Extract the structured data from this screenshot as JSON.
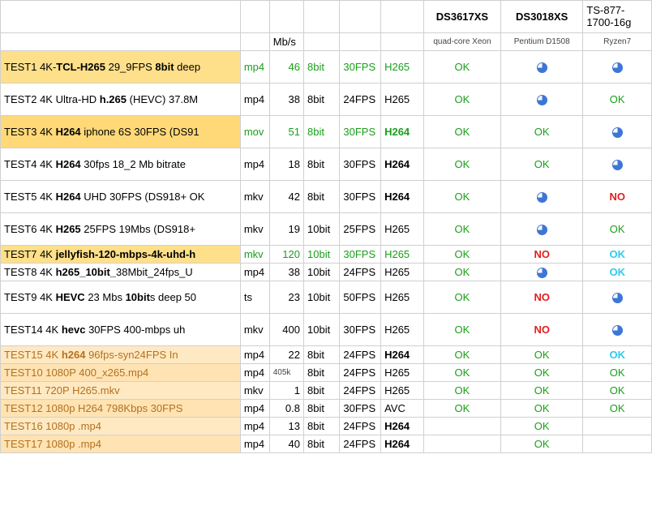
{
  "headers": {
    "r1": {
      "m1": "DS3617XS",
      "m2": "DS3018XS",
      "m3": "TS-877-1700-16g"
    },
    "r2": {
      "mb": "Mb/s",
      "m1": "quad-core Xeon",
      "m2": "Pentium D1508",
      "m3": "Ryzen7"
    }
  },
  "rows": [
    {
      "big": true,
      "bg": "bg-y1",
      "d": [
        [
          "TEST1 4K-"
        ],
        [
          "TCL-H265",
          "b"
        ],
        [
          " 29_9FPS "
        ],
        [
          "8bit",
          "b"
        ],
        [
          " deep"
        ]
      ],
      "dc": "",
      "ext": "mp4",
      "extc": "green",
      "mb": "46",
      "mbc": "r green",
      "bit": "8bit",
      "bitc": "green",
      "fps": "30FPS",
      "fpsc": "green",
      "cod": "H265",
      "codc": "green",
      "m1": "OK",
      "m2": "PIE",
      "m3": "PIE"
    },
    {
      "big": true,
      "bg": "",
      "d": [
        [
          "TEST2 4K Ultra-HD "
        ],
        [
          "h.265",
          "b"
        ],
        [
          " (HEVC) 37.8M"
        ]
      ],
      "dc": "",
      "ext": "mp4",
      "extc": "",
      "mb": "38",
      "mbc": "r",
      "bit": "8bit",
      "bitc": "",
      "fps": "24FPS",
      "fpsc": "",
      "cod": "H265",
      "codc": "",
      "m1": "OK",
      "m2": "PIE",
      "m3": "OK"
    },
    {
      "big": true,
      "bg": "bg-y2",
      "d": [
        [
          "TEST3 4K "
        ],
        [
          "H264",
          "b"
        ],
        [
          " iphone 6S 30FPS (DS91"
        ]
      ],
      "dc": "",
      "ext": "mov",
      "extc": "green",
      "mb": "51",
      "mbc": "r green",
      "bit": "8bit",
      "bitc": "green",
      "fps": "30FPS",
      "fpsc": "green",
      "cod": "H264",
      "codc": "green bold",
      "m1": "OK",
      "m2": "OK",
      "m3": "PIE"
    },
    {
      "big": true,
      "bg": "",
      "d": [
        [
          "TEST4 4K "
        ],
        [
          "H264",
          "b"
        ],
        [
          " 30fps 18_2 Mb bitrate"
        ]
      ],
      "dc": "",
      "ext": "mp4",
      "extc": "",
      "mb": "18",
      "mbc": "r",
      "bit": "8bit",
      "bitc": "",
      "fps": "30FPS",
      "fpsc": "",
      "cod": "H264",
      "codc": "bold",
      "m1": "OK",
      "m2": "OK",
      "m3": "PIE"
    },
    {
      "big": true,
      "bg": "",
      "d": [
        [
          "TEST5 4K "
        ],
        [
          "H264",
          "b"
        ],
        [
          " UHD 30FPS (DS918+ OK"
        ]
      ],
      "dc": "",
      "ext": "mkv",
      "extc": "",
      "mb": "42",
      "mbc": "r",
      "bit": "8bit",
      "bitc": "",
      "fps": "30FPS",
      "fpsc": "",
      "cod": "H264",
      "codc": "bold",
      "m1": "OK",
      "m2": "PIE",
      "m3": "NO"
    },
    {
      "big": true,
      "bg": "",
      "d": [
        [
          "TEST6 4K "
        ],
        [
          "H265",
          "b"
        ],
        [
          " 25FPS 19Mbs (DS918+ "
        ]
      ],
      "dc": "",
      "ext": "mkv",
      "extc": "",
      "mb": "19",
      "mbc": "r",
      "bit": "10bit",
      "bitc": "",
      "fps": "25FPS",
      "fpsc": "",
      "cod": "H265",
      "codc": "",
      "m1": "OK",
      "m2": "PIE",
      "m3": "OK"
    },
    {
      "big": false,
      "bg": "bg-y1",
      "d": [
        [
          "TEST7 4K "
        ],
        [
          "jellyfish-120-mbps-4k-uhd-h",
          "b"
        ]
      ],
      "dc": "",
      "ext": "mkv",
      "extc": "green",
      "mb": "120",
      "mbc": "r green",
      "bit": "10bit",
      "bitc": "green",
      "fps": "30FPS",
      "fpsc": "green",
      "cod": "H265",
      "codc": "green",
      "m1": "OK",
      "m2": "NO",
      "m3": "OKc"
    },
    {
      "big": false,
      "bg": "",
      "d": [
        [
          "TEST8 4K "
        ],
        [
          "h265_10bit_",
          "b"
        ],
        [
          "38Mbit_24fps_U"
        ]
      ],
      "dc": "",
      "ext": "mp4",
      "extc": "",
      "mb": "38",
      "mbc": "r",
      "bit": "10bit",
      "bitc": "",
      "fps": "24FPS",
      "fpsc": "",
      "cod": "H265",
      "codc": "",
      "m1": "OK",
      "m2": "PIE",
      "m3": "OKc"
    },
    {
      "big": true,
      "bg": "",
      "d": [
        [
          "TEST9 4K "
        ],
        [
          "HEVC",
          "b"
        ],
        [
          " 23 Mbs "
        ],
        [
          "10bit",
          "b"
        ],
        [
          "s deep 50"
        ]
      ],
      "dc": "",
      "ext": "ts",
      "extc": "",
      "mb": "23",
      "mbc": "r",
      "bit": "10bit",
      "bitc": "",
      "fps": "50FPS",
      "fpsc": "",
      "cod": "H265",
      "codc": "",
      "m1": "OK",
      "m2": "NO",
      "m3": "PIE"
    },
    {
      "big": true,
      "bg": "",
      "d": [
        [
          "TEST14 4K "
        ],
        [
          "hevc",
          "b"
        ],
        [
          " 30FPS 400-mbps uh"
        ]
      ],
      "dc": "",
      "ext": "mkv",
      "extc": "",
      "mb": "400",
      "mbc": "r",
      "bit": "10bit",
      "bitc": "",
      "fps": "30FPS",
      "fpsc": "",
      "cod": "H265",
      "codc": "",
      "m1": "OK",
      "m2": "NO",
      "m3": "PIE"
    },
    {
      "big": false,
      "bg": "bg-o1",
      "d": [
        [
          "TEST15 4K "
        ],
        [
          "h264",
          "b"
        ],
        [
          " 96fps-syn24FPS In"
        ]
      ],
      "dc": "brown",
      "ext": "mp4",
      "extc": "",
      "mb": "22",
      "mbc": "r",
      "bit": "8bit",
      "bitc": "",
      "fps": "24FPS",
      "fpsc": "",
      "cod": "H264",
      "codc": "bold",
      "m1": "OK",
      "m2": "OK",
      "m3": "OKc"
    },
    {
      "big": false,
      "bg": "bg-o2",
      "d": [
        [
          "TEST10 1080P 400_x265.mp4"
        ]
      ],
      "dc": "brown",
      "ext": "mp4",
      "extc": "",
      "mb": "405k",
      "mbc": "sub",
      "bit": "8bit",
      "bitc": "",
      "fps": "24FPS",
      "fpsc": "",
      "cod": "H265",
      "codc": "",
      "m1": "OK",
      "m2": "OK",
      "m3": "OK"
    },
    {
      "big": false,
      "bg": "bg-o1",
      "d": [
        [
          "TEST11 720P H265.mkv"
        ]
      ],
      "dc": "brown",
      "ext": "mkv",
      "extc": "",
      "mb": "1",
      "mbc": "r",
      "bit": "8bit",
      "bitc": "",
      "fps": "24FPS",
      "fpsc": "",
      "cod": "H265",
      "codc": "",
      "m1": "OK",
      "m2": "OK",
      "m3": "OK"
    },
    {
      "big": false,
      "bg": "bg-o2",
      "d": [
        [
          "TEST12 1080p H264 798Kbps 30FPS"
        ]
      ],
      "dc": "brown",
      "ext": "mp4",
      "extc": "",
      "mb": "0.8",
      "mbc": "r",
      "bit": "8bit",
      "bitc": "",
      "fps": "30FPS",
      "fpsc": "",
      "cod": "AVC",
      "codc": "",
      "m1": "OK",
      "m2": "OK",
      "m3": "OK"
    },
    {
      "big": false,
      "bg": "bg-o1",
      "d": [
        [
          "TEST16 1080p .mp4"
        ]
      ],
      "dc": "brown",
      "ext": "mp4",
      "extc": "",
      "mb": "13",
      "mbc": "r",
      "bit": "8bit",
      "bitc": "",
      "fps": "24FPS",
      "fpsc": "",
      "cod": "H264",
      "codc": "bold",
      "m1": "",
      "m2": "OK",
      "m3": ""
    },
    {
      "big": false,
      "bg": "bg-o2",
      "d": [
        [
          "TEST17 1080p .mp4"
        ]
      ],
      "dc": "brown",
      "ext": "mp4",
      "extc": "",
      "mb": "40",
      "mbc": "r",
      "bit": "8bit",
      "bitc": "",
      "fps": "24FPS",
      "fpsc": "",
      "cod": "H264",
      "codc": "bold",
      "m1": "",
      "m2": "OK",
      "m3": ""
    }
  ]
}
